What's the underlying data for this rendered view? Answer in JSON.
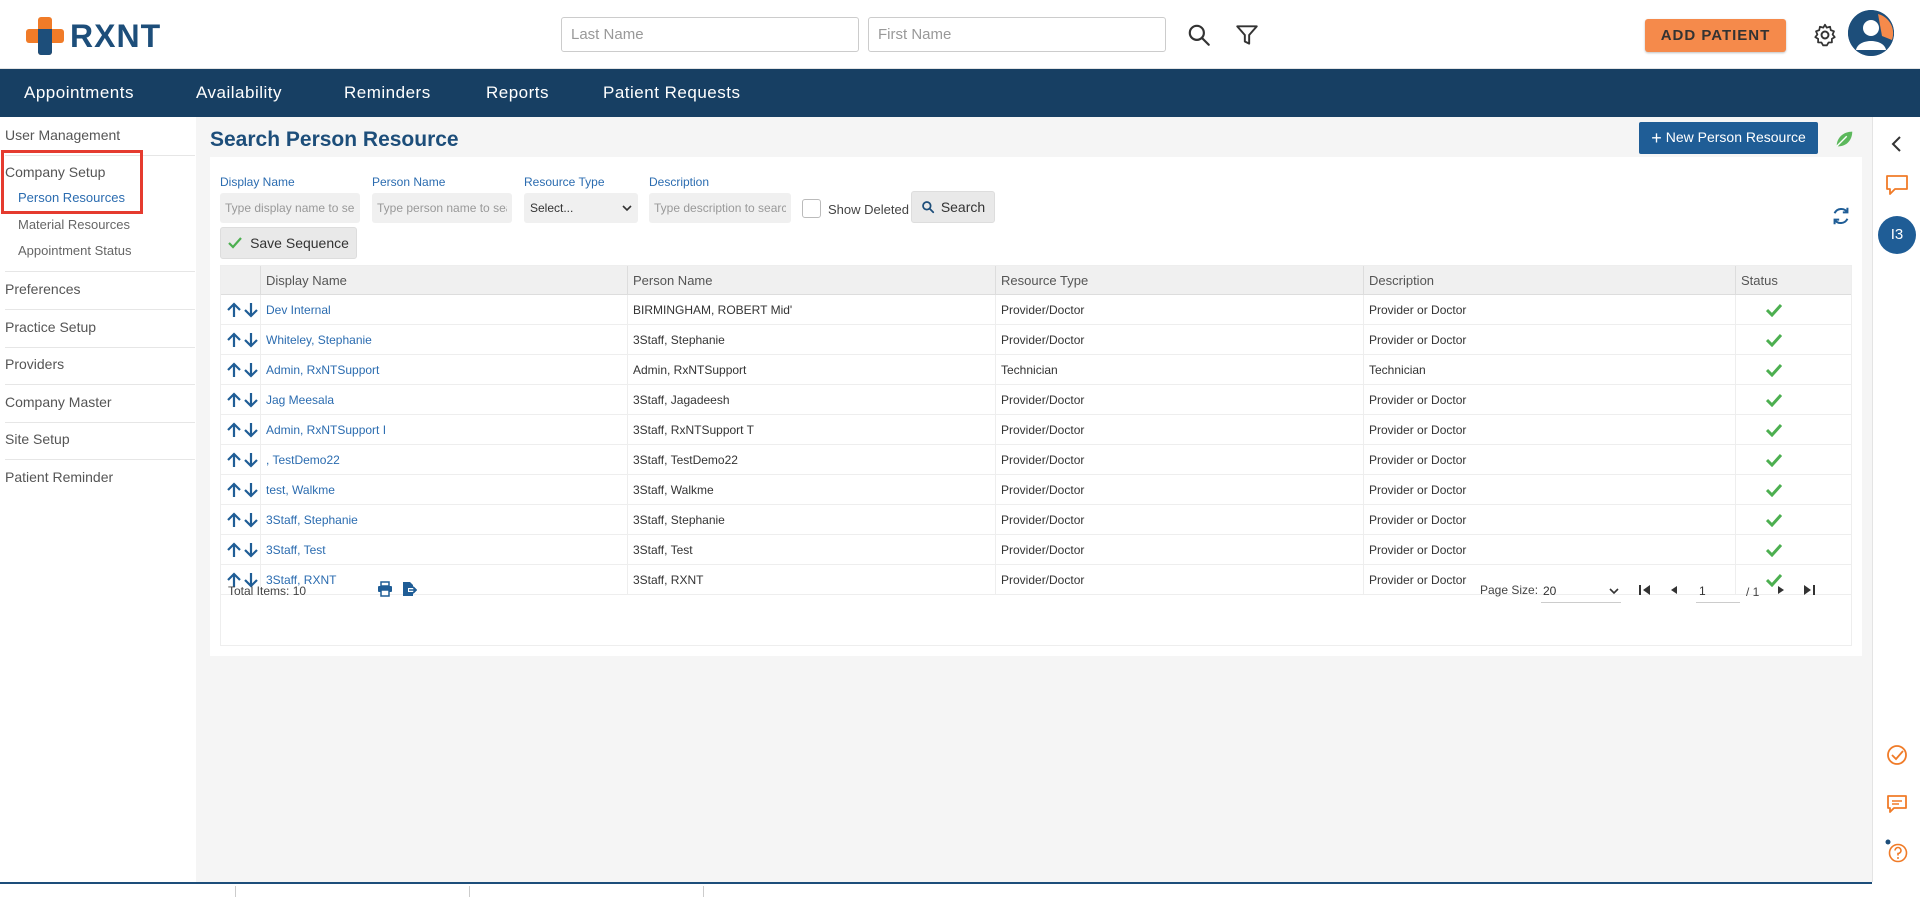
{
  "header": {
    "logo_text": "RXNT",
    "last_name_placeholder": "Last Name",
    "first_name_placeholder": "First Name",
    "add_patient_label": "ADD PATIENT"
  },
  "nav": {
    "items": [
      "Appointments",
      "Availability",
      "Reminders",
      "Reports",
      "Patient Requests"
    ]
  },
  "sidebar": {
    "user_management": "User Management",
    "company_setup": "Company Setup",
    "person_resources": "Person Resources",
    "material_resources": "Material Resources",
    "appointment_status": "Appointment Status",
    "preferences": "Preferences",
    "practice_setup": "Practice Setup",
    "providers": "Providers",
    "company_master": "Company Master",
    "site_setup": "Site Setup",
    "patient_reminder": "Patient Reminder"
  },
  "main": {
    "title": "Search Person Resource",
    "new_button": "New Person Resource",
    "filters": {
      "display_name_label": "Display Name",
      "display_name_placeholder": "Type display name to se",
      "person_name_label": "Person Name",
      "person_name_placeholder": "Type person name to sea",
      "resource_type_label": "Resource Type",
      "resource_type_value": "Select...",
      "description_label": "Description",
      "description_placeholder": "Type description to searc",
      "show_deleted_label": "Show Deleted",
      "search_button": "Search"
    },
    "save_sequence_label": "Save Sequence",
    "columns": [
      "Display Name",
      "Person Name",
      "Resource Type",
      "Description",
      "Status"
    ],
    "rows": [
      {
        "display": "Dev Internal",
        "person": "BIRMINGHAM, ROBERT Mid'",
        "type": "Provider/Doctor",
        "desc": "Provider or Doctor"
      },
      {
        "display": "Whiteley, Stephanie",
        "person": "3Staff, Stephanie",
        "type": "Provider/Doctor",
        "desc": "Provider or Doctor"
      },
      {
        "display": "Admin, RxNTSupport",
        "person": "Admin, RxNTSupport",
        "type": "Technician",
        "desc": "Technician"
      },
      {
        "display": "Jag Meesala",
        "person": "3Staff, Jagadeesh",
        "type": "Provider/Doctor",
        "desc": "Provider or Doctor"
      },
      {
        "display": "Admin, RxNTSupport I",
        "person": "3Staff, RxNTSupport T",
        "type": "Provider/Doctor",
        "desc": "Provider or Doctor"
      },
      {
        "display": ", TestDemo22",
        "person": "3Staff, TestDemo22",
        "type": "Provider/Doctor",
        "desc": "Provider or Doctor"
      },
      {
        "display": "test, Walkme",
        "person": "3Staff, Walkme",
        "type": "Provider/Doctor",
        "desc": "Provider or Doctor"
      },
      {
        "display": "3Staff, Stephanie",
        "person": "3Staff, Stephanie",
        "type": "Provider/Doctor",
        "desc": "Provider or Doctor"
      },
      {
        "display": "3Staff, Test",
        "person": "3Staff, Test",
        "type": "Provider/Doctor",
        "desc": "Provider or Doctor"
      },
      {
        "display": "3Staff, RXNT",
        "person": "3Staff, RXNT",
        "type": "Provider/Doctor",
        "desc": "Provider or Doctor"
      }
    ],
    "pager": {
      "total_items": "Total Items: 10",
      "page_size_label": "Page Size:",
      "page_size_value": "20",
      "current_page": "1",
      "page_of": "/ 1"
    }
  },
  "rail": {
    "badge": "I3"
  },
  "colors": {
    "brand_navy": "#173f63",
    "brand_orange": "#f07b28",
    "link_blue": "#2b6cb0",
    "status_green": "#4caf50",
    "highlight_red": "#e53b2f"
  }
}
